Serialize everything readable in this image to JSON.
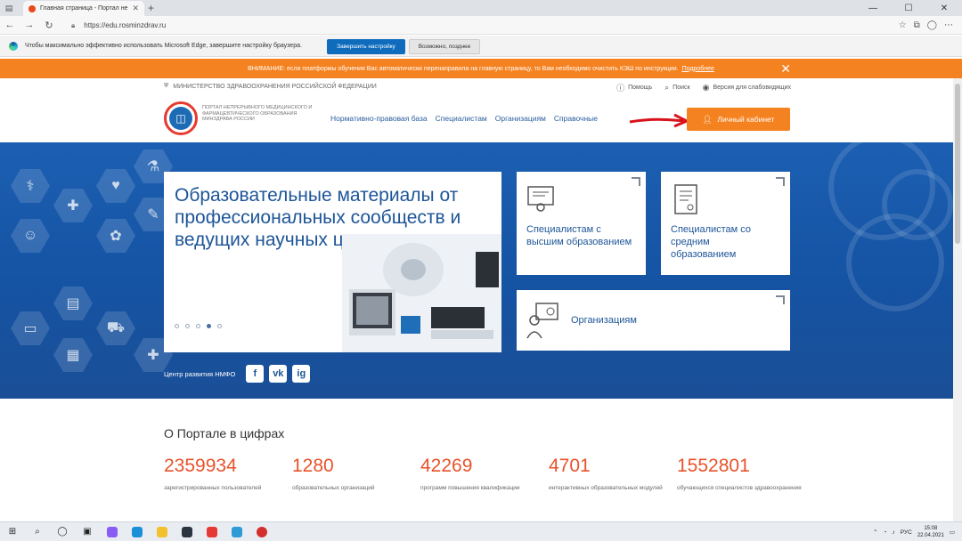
{
  "browser": {
    "tab_title": "Главная страница - Портал не",
    "url": "https://edu.rosminzdrav.ru",
    "infobar_text": "Чтобы максимально эффективно использовать Microsoft Edge, завершите настройку браузера.",
    "infobar_primary": "Завершить настройку",
    "infobar_secondary": "Возможно, позднее"
  },
  "warning": {
    "text": "ВНИМАНИЕ: если платформы обучения Вас автоматически перенаправила на главную страницу, то Вам необходимо очистить КЭШ по инструкции.",
    "link": "Подробнее"
  },
  "topline": {
    "ministry": "МИНИСТЕРСТВО ЗДРАВООХРАНЕНИЯ РОССИЙСКОЙ ФЕДЕРАЦИИ",
    "help": "Помощь",
    "search": "Поиск",
    "accessibility": "Версия для слабовидящих"
  },
  "header": {
    "logo_text": "ПОРТАЛ НЕПРЕРЫВНОГО МЕДИЦИНСКОГО И ФАРМАЦЕВТИЧЕСКОГО ОБРАЗОВАНИЯ МИНЗДРАВА РОССИИ",
    "nav": [
      "Нормативно-правовая база",
      "Специалистам",
      "Организациям",
      "Справочные"
    ],
    "cabinet": "Личный кабинет"
  },
  "hero": {
    "slide_title": "Образовательные материалы от профессиональных сообществ и ведущих научных центров",
    "cards": {
      "higher": "Специалистам с высшим образованием",
      "middle": "Специалистам со средним образованием",
      "orgs": "Организациям"
    },
    "social_label": "Центр развития НМФО",
    "social": [
      "f",
      "vk",
      "ig"
    ]
  },
  "stats": {
    "title": "О Портале в цифрах",
    "items": [
      {
        "value": "2359934",
        "label": "зарегистрированных пользователей"
      },
      {
        "value": "1280",
        "label": "образовательных организаций"
      },
      {
        "value": "42269",
        "label": "программ повышения квалификации"
      },
      {
        "value": "4701",
        "label": "интерактивных образовательных модулей"
      },
      {
        "value": "1552801",
        "label": "обучающихся специалистов здравоохранения"
      }
    ]
  },
  "taskbar": {
    "lang": "РУС",
    "time": "15:08",
    "date": "22.04.2021"
  },
  "colors": {
    "orange": "#f58220",
    "blue": "#1d5598",
    "stat_red": "#e8532b"
  }
}
